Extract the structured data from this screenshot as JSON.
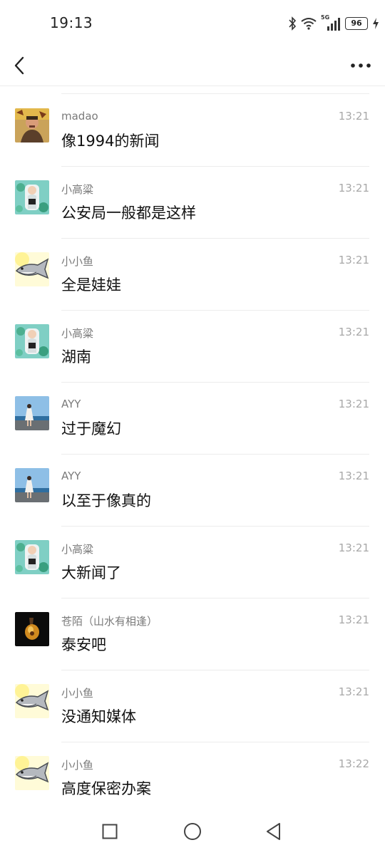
{
  "status_bar": {
    "time": "19:13",
    "signal_label": "5G",
    "battery": "96",
    "icons": [
      "bluetooth-icon",
      "wifi-icon",
      "cellular-signal-icon",
      "battery-icon",
      "charging-icon"
    ]
  },
  "nav": {
    "back_icon": "chevron-left-icon",
    "more_icon": "more-dots-icon"
  },
  "messages": [
    {
      "sender": "madao",
      "time": "13:21",
      "text": "像1994的新闻",
      "avatar": "avatar-madao"
    },
    {
      "sender": "小高粱",
      "time": "13:21",
      "text": "公安局一般都是这样",
      "avatar": "avatar-xiaogaoliang"
    },
    {
      "sender": "小小鱼",
      "time": "13:21",
      "text": "全是娃娃",
      "avatar": "avatar-xiaoxiaoyu"
    },
    {
      "sender": "小高粱",
      "time": "13:21",
      "text": "湖南",
      "avatar": "avatar-xiaogaoliang"
    },
    {
      "sender": "AYY",
      "time": "13:21",
      "text": "过于魔幻",
      "avatar": "avatar-ayy"
    },
    {
      "sender": "AYY",
      "time": "13:21",
      "text": "以至于像真的",
      "avatar": "avatar-ayy"
    },
    {
      "sender": "小高粱",
      "time": "13:21",
      "text": "大新闻了",
      "avatar": "avatar-xiaogaoliang"
    },
    {
      "sender": "苍陌（山水有相逢）",
      "time": "13:21",
      "text": "泰安吧",
      "avatar": "avatar-cangmo"
    },
    {
      "sender": "小小鱼",
      "time": "13:21",
      "text": "没通知媒体",
      "avatar": "avatar-xiaoxiaoyu"
    },
    {
      "sender": "小小鱼",
      "time": "13:22",
      "text": "高度保密办案",
      "avatar": "avatar-xiaoxiaoyu"
    }
  ],
  "system_nav": {
    "icons": [
      "recent-apps-square-icon",
      "home-circle-icon",
      "back-triangle-icon"
    ]
  }
}
